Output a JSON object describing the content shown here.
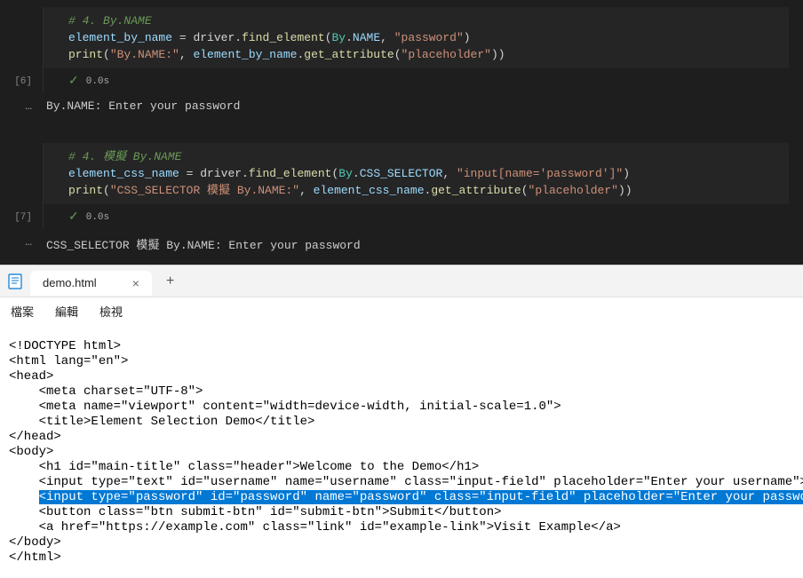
{
  "notebook": {
    "cell1": {
      "num": "[6]",
      "comment": "# 4. By.NAME",
      "line1": {
        "var": "element_by_name",
        "eq": " = ",
        "driver": "driver",
        "dot1": ".",
        "find": "find_element",
        "p1": "(",
        "byclass": "By",
        "dot2": ".",
        "byprop": "NAME",
        "comma": ", ",
        "arg": "\"password\"",
        "p2": ")"
      },
      "line2": {
        "print": "print",
        "p1": "(",
        "s1": "\"By.NAME:\"",
        "comma": ", ",
        "var": "element_by_name",
        "dot": ".",
        "get": "get_attribute",
        "p2": "(",
        "s2": "\"placeholder\"",
        "p3": "))"
      },
      "exec_time": "0.0s",
      "output": "By.NAME: Enter your password"
    },
    "cell2": {
      "num": "[7]",
      "comment": "# 4. 模擬 By.NAME",
      "line1": {
        "var": "element_css_name",
        "eq": " = ",
        "driver": "driver",
        "dot1": ".",
        "find": "find_element",
        "p1": "(",
        "byclass": "By",
        "dot2": ".",
        "byprop": "CSS_SELECTOR",
        "comma": ", ",
        "arg": "\"input[name='password']\"",
        "p2": ")"
      },
      "line2": {
        "print": "print",
        "p1": "(",
        "s1": "\"CSS_SELECTOR 模擬 By.NAME:\"",
        "comma": ", ",
        "var": "element_css_name",
        "dot": ".",
        "get": "get_attribute",
        "p2": "(",
        "s2": "\"placeholder\"",
        "p3": "))"
      },
      "exec_time": "0.0s",
      "output": "CSS_SELECTOR 模擬 By.NAME: Enter your password"
    },
    "dots": "…"
  },
  "editor": {
    "tab_name": "demo.html",
    "close": "×",
    "plus": "+",
    "menu": {
      "file": "檔案",
      "edit": "編輯",
      "view": "檢視"
    },
    "lines": {
      "l1": "<!DOCTYPE html>",
      "l2": "<html lang=\"en\">",
      "l3": "<head>",
      "l4": "    <meta charset=\"UTF-8\">",
      "l5": "    <meta name=\"viewport\" content=\"width=device-width, initial-scale=1.0\">",
      "l6": "    <title>Element Selection Demo</title>",
      "l7": "</head>",
      "l8": "<body>",
      "l9": "    <h1 id=\"main-title\" class=\"header\">Welcome to the Demo</h1>",
      "l10": "    <input type=\"text\" id=\"username\" name=\"username\" class=\"input-field\" placeholder=\"Enter your username\">",
      "l11_pre": "    ",
      "l11_hl": "<input type=\"password\" id=\"password\" name=\"password\" class=\"input-field\" placeholder=\"Enter your password\">",
      "l12": "    <button class=\"btn submit-btn\" id=\"submit-btn\">Submit</button>",
      "l13": "    <a href=\"https://example.com\" class=\"link\" id=\"example-link\">Visit Example</a>",
      "l14": "</body>",
      "l15": "</html>"
    }
  }
}
